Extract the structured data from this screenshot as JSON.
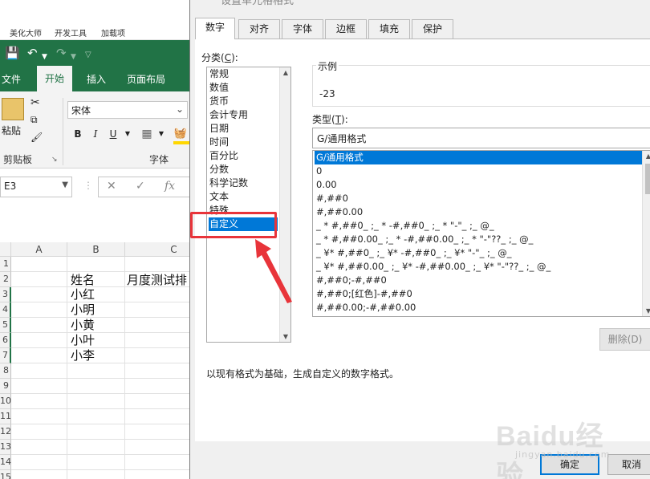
{
  "excel": {
    "addin_tabs": [
      "美化大师",
      "开发工具",
      "加载项"
    ],
    "ribbon_tabs": [
      "文件",
      "开始",
      "插入",
      "页面布局"
    ],
    "active_tab": "开始",
    "paste_label": "粘贴",
    "clipboard_label": "剪贴板",
    "font_name": "宋体",
    "bold": "B",
    "italic": "I",
    "underline": "U",
    "font_group_label": "字体",
    "name_box": "E3",
    "fx": "fx",
    "columns": [
      "A",
      "B",
      "C"
    ],
    "rows": [
      "1",
      "2",
      "3",
      "4",
      "5",
      "6",
      "7",
      "8",
      "9",
      "10",
      "11",
      "12",
      "13",
      "14",
      "15"
    ],
    "header_b": "姓名",
    "header_c": "月度测试排",
    "names": [
      "小红",
      "小明",
      "小黄",
      "小叶",
      "小李"
    ]
  },
  "dialog": {
    "title": "设置单元格格式",
    "tabs": [
      "数字",
      "对齐",
      "字体",
      "边框",
      "填充",
      "保护"
    ],
    "active_tab": "数字",
    "category_label": "分类(",
    "category_key": "C",
    "category_label_end": "):",
    "categories": [
      "常规",
      "数值",
      "货币",
      "会计专用",
      "日期",
      "时间",
      "百分比",
      "分数",
      "科学记数",
      "文本",
      "特殊",
      "自定义"
    ],
    "selected_category": "自定义",
    "sample_label": "示例",
    "sample_value": "-23",
    "type_label": "类型(",
    "type_key": "T",
    "type_label_end": "):",
    "type_value": "G/通用格式",
    "formats": [
      "G/通用格式",
      "0",
      "0.00",
      "#,##0",
      "#,##0.00",
      "_ * #,##0_ ;_ * -#,##0_ ;_ * \"-\"_ ;_ @_",
      "_ * #,##0.00_ ;_ * -#,##0.00_ ;_ * \"-\"??_ ;_ @_",
      "_ ¥* #,##0_ ;_ ¥* -#,##0_ ;_ ¥* \"-\"_ ;_ @_",
      "_ ¥* #,##0.00_ ;_ ¥* -#,##0.00_ ;_ ¥* \"-\"??_ ;_ @_",
      "#,##0;-#,##0",
      "#,##0;[红色]-#,##0",
      "#,##0.00;-#,##0.00"
    ],
    "selected_format": "G/通用格式",
    "delete_label": "删除(D)",
    "description": "以现有格式为基础，生成自定义的数字格式。",
    "ok_label": "确定",
    "cancel_label": "取消"
  },
  "watermark": {
    "text": "Baidu经验",
    "url": "jingyan.baidu.com"
  },
  "colors": {
    "excel_green": "#217346",
    "selection_blue": "#0078d7",
    "annotation_red": "#e8343a"
  }
}
